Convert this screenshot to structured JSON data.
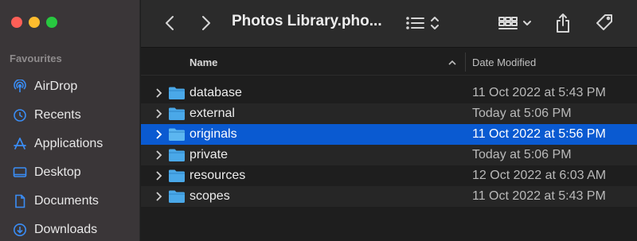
{
  "window": {
    "title": "Photos Library.pho..."
  },
  "sidebar": {
    "section": "Favourites",
    "items": [
      {
        "label": "AirDrop",
        "icon": "airdrop-icon"
      },
      {
        "label": "Recents",
        "icon": "clock-icon"
      },
      {
        "label": "Applications",
        "icon": "applications-icon"
      },
      {
        "label": "Desktop",
        "icon": "desktop-icon"
      },
      {
        "label": "Documents",
        "icon": "document-icon"
      },
      {
        "label": "Downloads",
        "icon": "downloads-icon"
      }
    ]
  },
  "columns": {
    "name": "Name",
    "date": "Date Modified"
  },
  "files": [
    {
      "name": "database",
      "date": "11 Oct 2022 at 5:43 PM",
      "selected": false
    },
    {
      "name": "external",
      "date": "Today at 5:06 PM",
      "selected": false
    },
    {
      "name": "originals",
      "date": "11 Oct 2022 at 5:56 PM",
      "selected": true
    },
    {
      "name": "private",
      "date": "Today at 5:06 PM",
      "selected": false
    },
    {
      "name": "resources",
      "date": "12 Oct 2022 at 6:03 AM",
      "selected": false
    },
    {
      "name": "scopes",
      "date": "11 Oct 2022 at 5:43 PM",
      "selected": false
    }
  ],
  "colors": {
    "accent": "#3a8df5",
    "selection": "#0a5ad1",
    "folder": "#4aa8e8"
  }
}
